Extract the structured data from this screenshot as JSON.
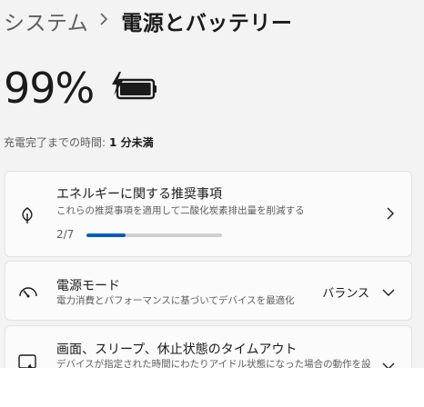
{
  "breadcrumb": {
    "parent": "システム",
    "current": "電源とバッテリー"
  },
  "battery": {
    "percent": "99%",
    "level": 0.99,
    "charging": true
  },
  "charge_status": {
    "label": "充電完了までの時間:",
    "value": "1 分未満"
  },
  "recommendations": {
    "title": "エネルギーに関する推奨事項",
    "description": "これらの推奨事項を適用して二酸化炭素排出量を削減する",
    "progress_label": "2/7",
    "progress": 0.286,
    "icon": "leaf-icon"
  },
  "power_mode": {
    "title": "電源モード",
    "description": "電力消費とパフォーマンスに基づいてデバイスを最適化",
    "value": "バランス",
    "icon": "gauge-icon"
  },
  "screen_sleep": {
    "title": "画面、スリープ、休止状態のタイムアウト",
    "description": "デバイスが指定された時間にわたりアイドル状態になった場合の動作を設",
    "icon": "screen-sleep-icon"
  },
  "colors": {
    "accent": "#005fb8",
    "background": "#f3f3f3",
    "card": "#fbfbfb"
  }
}
